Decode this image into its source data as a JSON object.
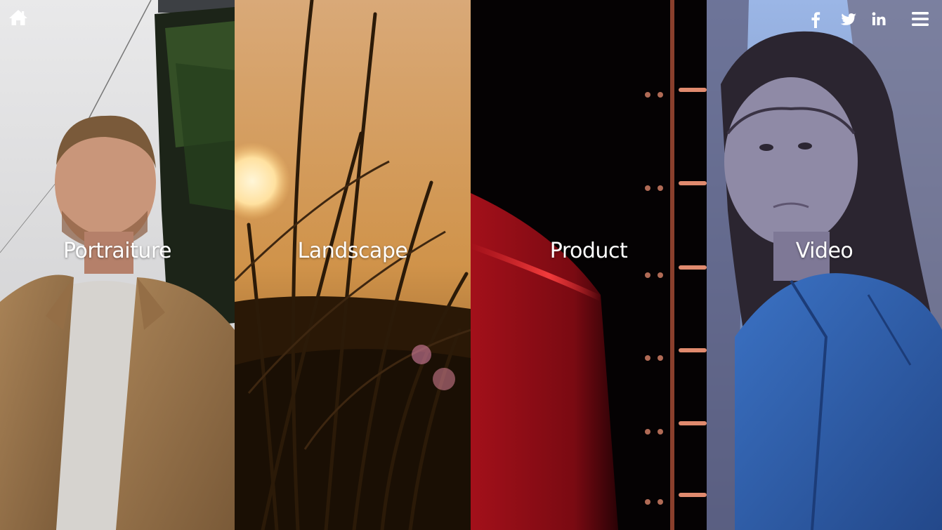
{
  "nav": {
    "home_icon": "home-icon",
    "social": [
      {
        "name": "facebook",
        "icon": "facebook-icon"
      },
      {
        "name": "twitter",
        "icon": "twitter-icon"
      },
      {
        "name": "linkedin",
        "icon": "linkedin-icon"
      }
    ],
    "menu_icon": "hamburger-menu-icon"
  },
  "categories": [
    {
      "label": "Portraiture"
    },
    {
      "label": "Landscape"
    },
    {
      "label": "Product"
    },
    {
      "label": "Video"
    }
  ],
  "colors": {
    "text": "#ffffff",
    "landscape_tone": "#d4a060",
    "product_red": "#c8101c",
    "video_blue": "#2f62b0"
  }
}
